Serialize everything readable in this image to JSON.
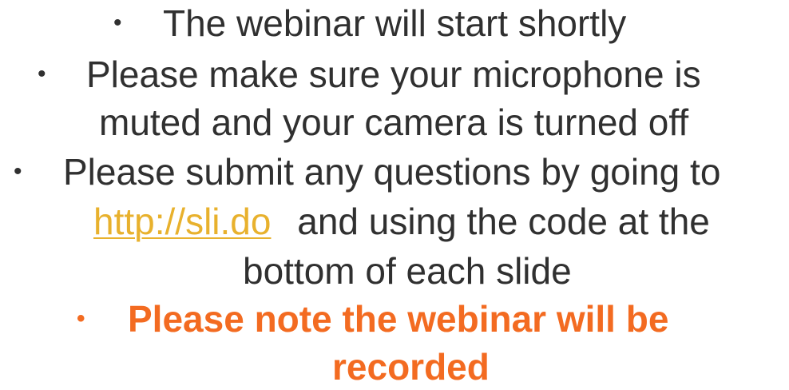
{
  "slide": {
    "bullets": [
      {
        "lines": [
          "The webinar will start shortly"
        ]
      },
      {
        "lines": [
          "Please make sure your microphone is",
          "muted and your camera is turned off"
        ]
      },
      {
        "lines": [
          "Please submit any questions by going to",
          "and using the code at the",
          "bottom of each slide"
        ],
        "link_text": "http://sli.do"
      },
      {
        "lines": [
          "Please note the webinar will be",
          "recorded"
        ]
      }
    ],
    "bullet_symbol": "•",
    "colors": {
      "body_text": "#303030",
      "link": "#e8b12d",
      "emphasis": "#f36b21",
      "background": "#ffffff"
    }
  }
}
